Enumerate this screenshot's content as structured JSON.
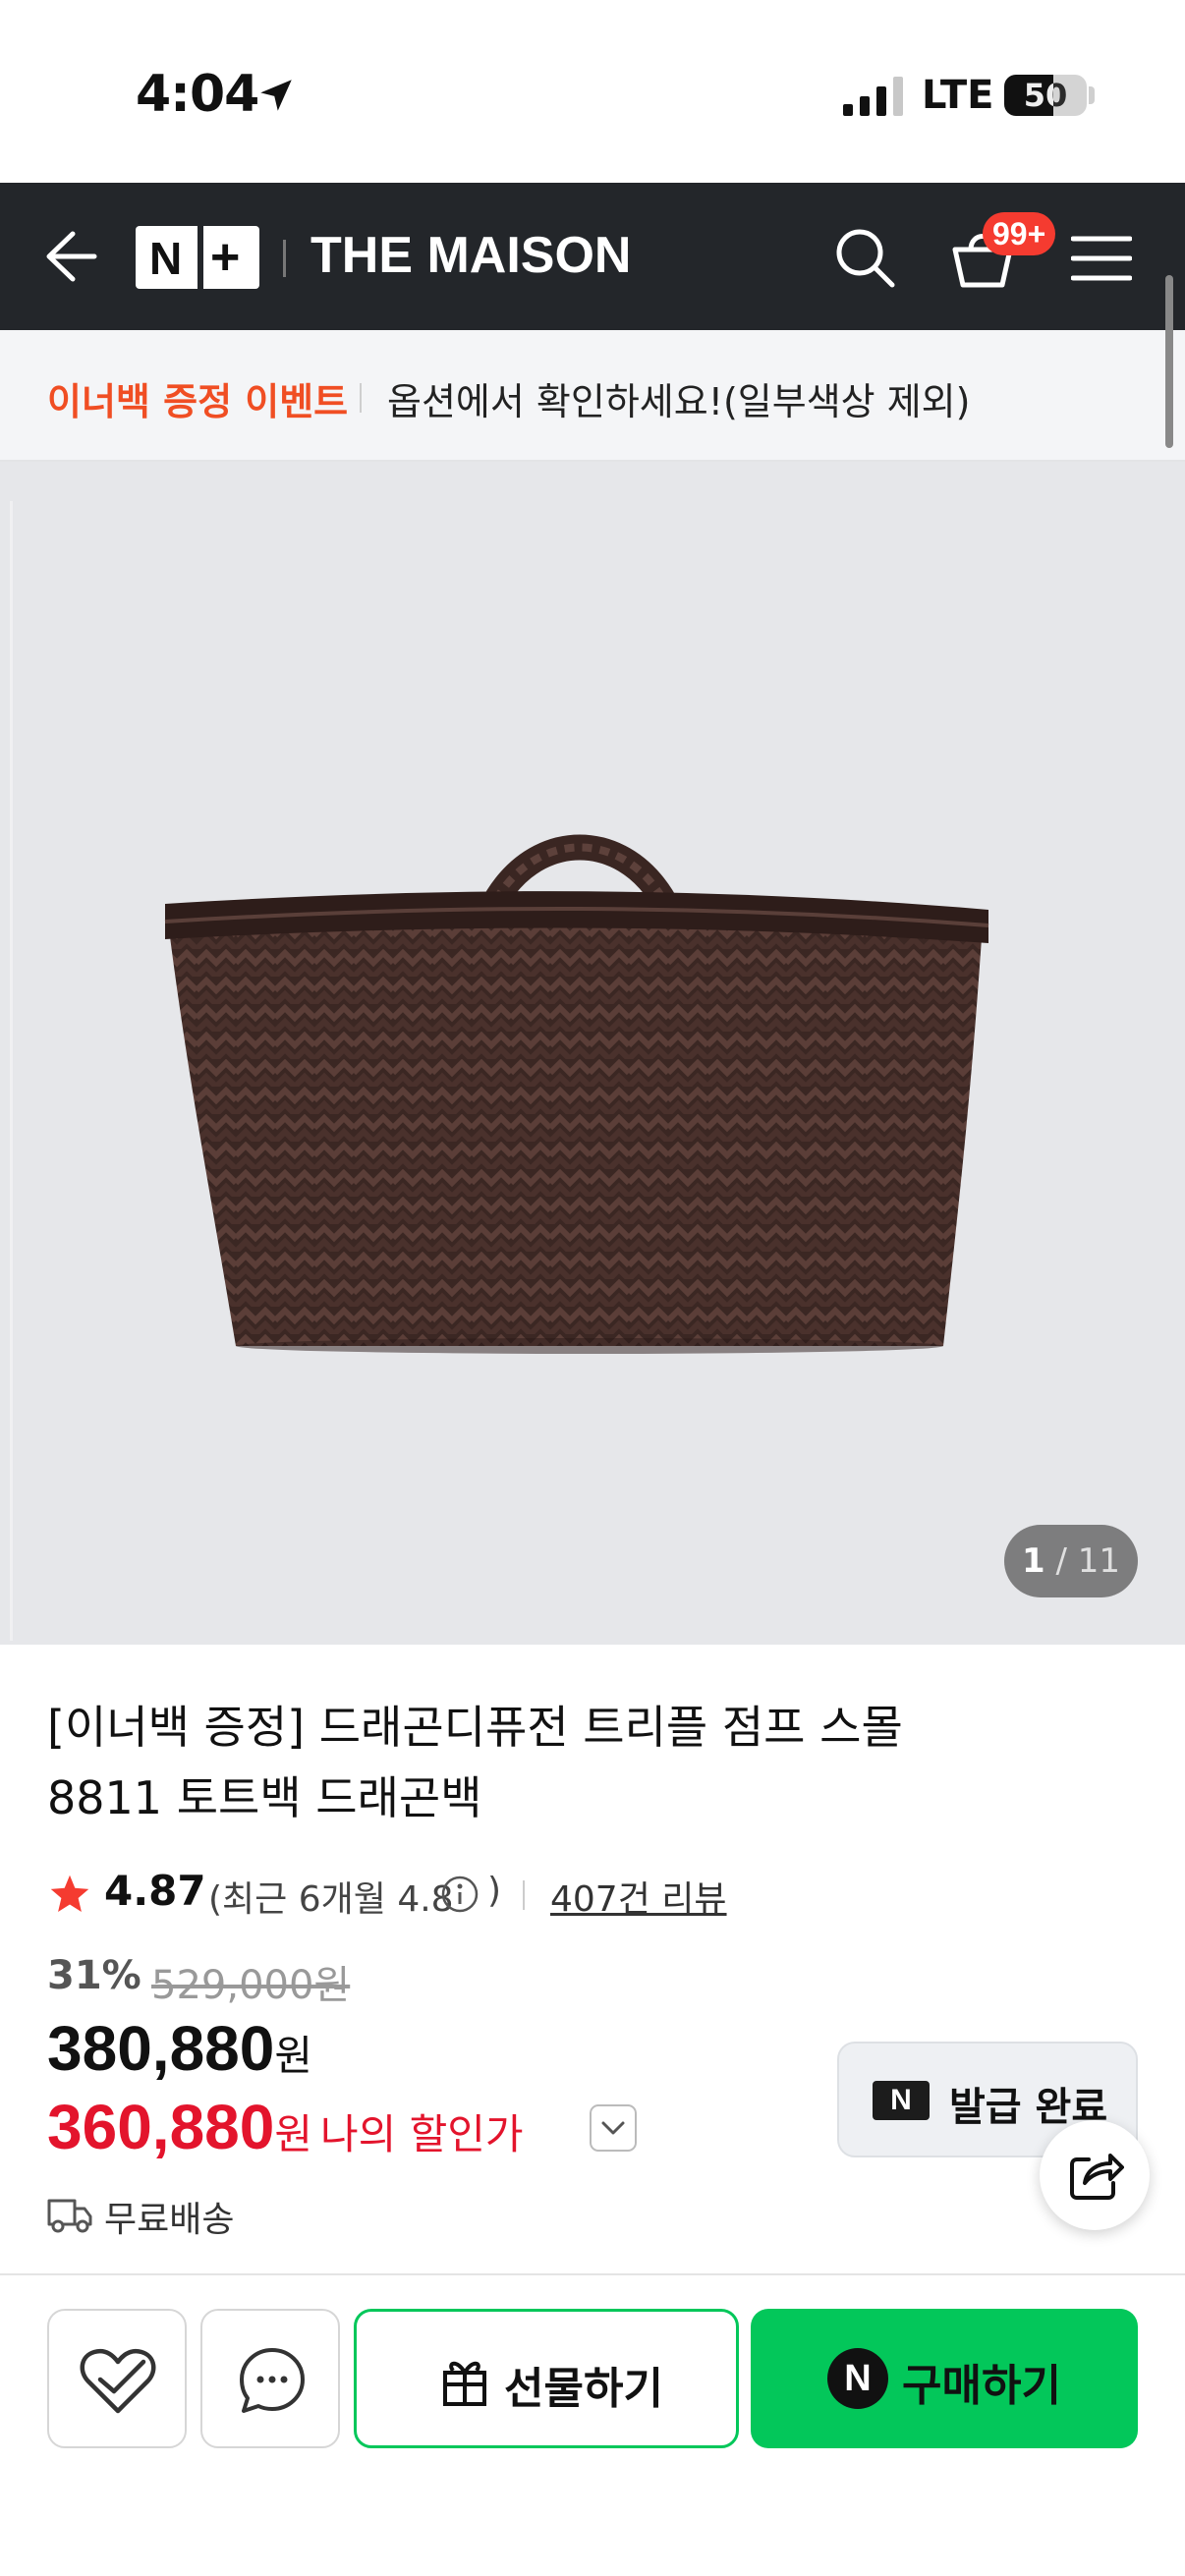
{
  "status": {
    "time": "4:04",
    "network": "LTE",
    "battery": "50"
  },
  "header": {
    "logo_n": "N",
    "logo_plus": "+",
    "brand": "THE MAISON",
    "cart_count": "99+"
  },
  "event": {
    "title": "이너백 증정 이벤트",
    "desc": "옵션에서 확인하세요!(일부색상 제외)"
  },
  "gallery": {
    "current": "1",
    "total": "11",
    "separator": " / "
  },
  "product": {
    "title": "[이너백 증정] 드래곤디퓨전 트리플 점프 스몰 8811 토트백 드래곤백",
    "rating": "4.87",
    "rating_recent": "(최근 6개월 4.8",
    "rating_recent_close": ")",
    "review_count": "407건 리뷰",
    "discount_rate": "31%",
    "original_price": "529,000원",
    "sale_price": "380,880",
    "my_price": "360,880",
    "currency": "원",
    "my_price_label": "나의 할인가",
    "shipping": "무료배송"
  },
  "coupon": {
    "badge": "N",
    "label": "발급 완료"
  },
  "actions": {
    "gift": "선물하기",
    "buy_badge": "N",
    "buy": "구매하기"
  },
  "colors": {
    "header_bg": "#23262a",
    "event_accent": "#f04e23",
    "price_red": "#e3142c",
    "naver_green": "#03c75a",
    "badge_red": "#f53b30"
  }
}
